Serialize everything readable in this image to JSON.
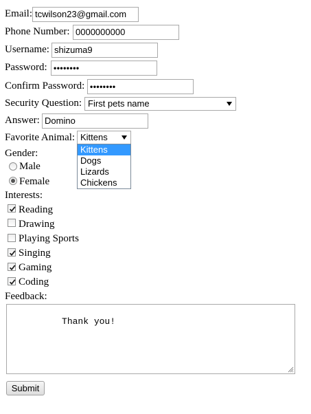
{
  "form": {
    "email": {
      "label": "Email:",
      "value": "tcwilson23@gmail.com"
    },
    "phone": {
      "label": "Phone Number:",
      "value": "0000000000"
    },
    "username": {
      "label": "Username:",
      "value": "shizuma9"
    },
    "password": {
      "label": "Password:",
      "value": "••••••••"
    },
    "confirm_password": {
      "label": "Confirm Password:",
      "value": "••••••••"
    },
    "security_question": {
      "label": "Security Question:",
      "selected": "First pets name"
    },
    "answer": {
      "label": "Answer:",
      "value": "Domino"
    },
    "favorite_animal": {
      "label": "Favorite Animal:",
      "selected": "Kittens",
      "options": [
        "Kittens",
        "Dogs",
        "Lizards",
        "Chickens"
      ]
    },
    "gender": {
      "label": "Gender:",
      "options": [
        {
          "label": "Male",
          "checked": false
        },
        {
          "label": "Female",
          "checked": true
        }
      ]
    },
    "interests": {
      "label": "Interests:",
      "options": [
        {
          "label": "Reading",
          "checked": true
        },
        {
          "label": "Drawing",
          "checked": false
        },
        {
          "label": "Playing Sports",
          "checked": false
        },
        {
          "label": "Singing",
          "checked": true
        },
        {
          "label": "Gaming",
          "checked": true
        },
        {
          "label": "Coding",
          "checked": true
        }
      ]
    },
    "feedback": {
      "label": "Feedback:",
      "value": "        Thank you!"
    },
    "submit_label": "Submit"
  },
  "icons": {
    "select_arrow": "chevron-down-icon",
    "checkmark": "checkmark-icon",
    "resize": "resize-grip-icon"
  },
  "colors": {
    "highlight": "#3399ff",
    "border": "#a9a9a9"
  }
}
